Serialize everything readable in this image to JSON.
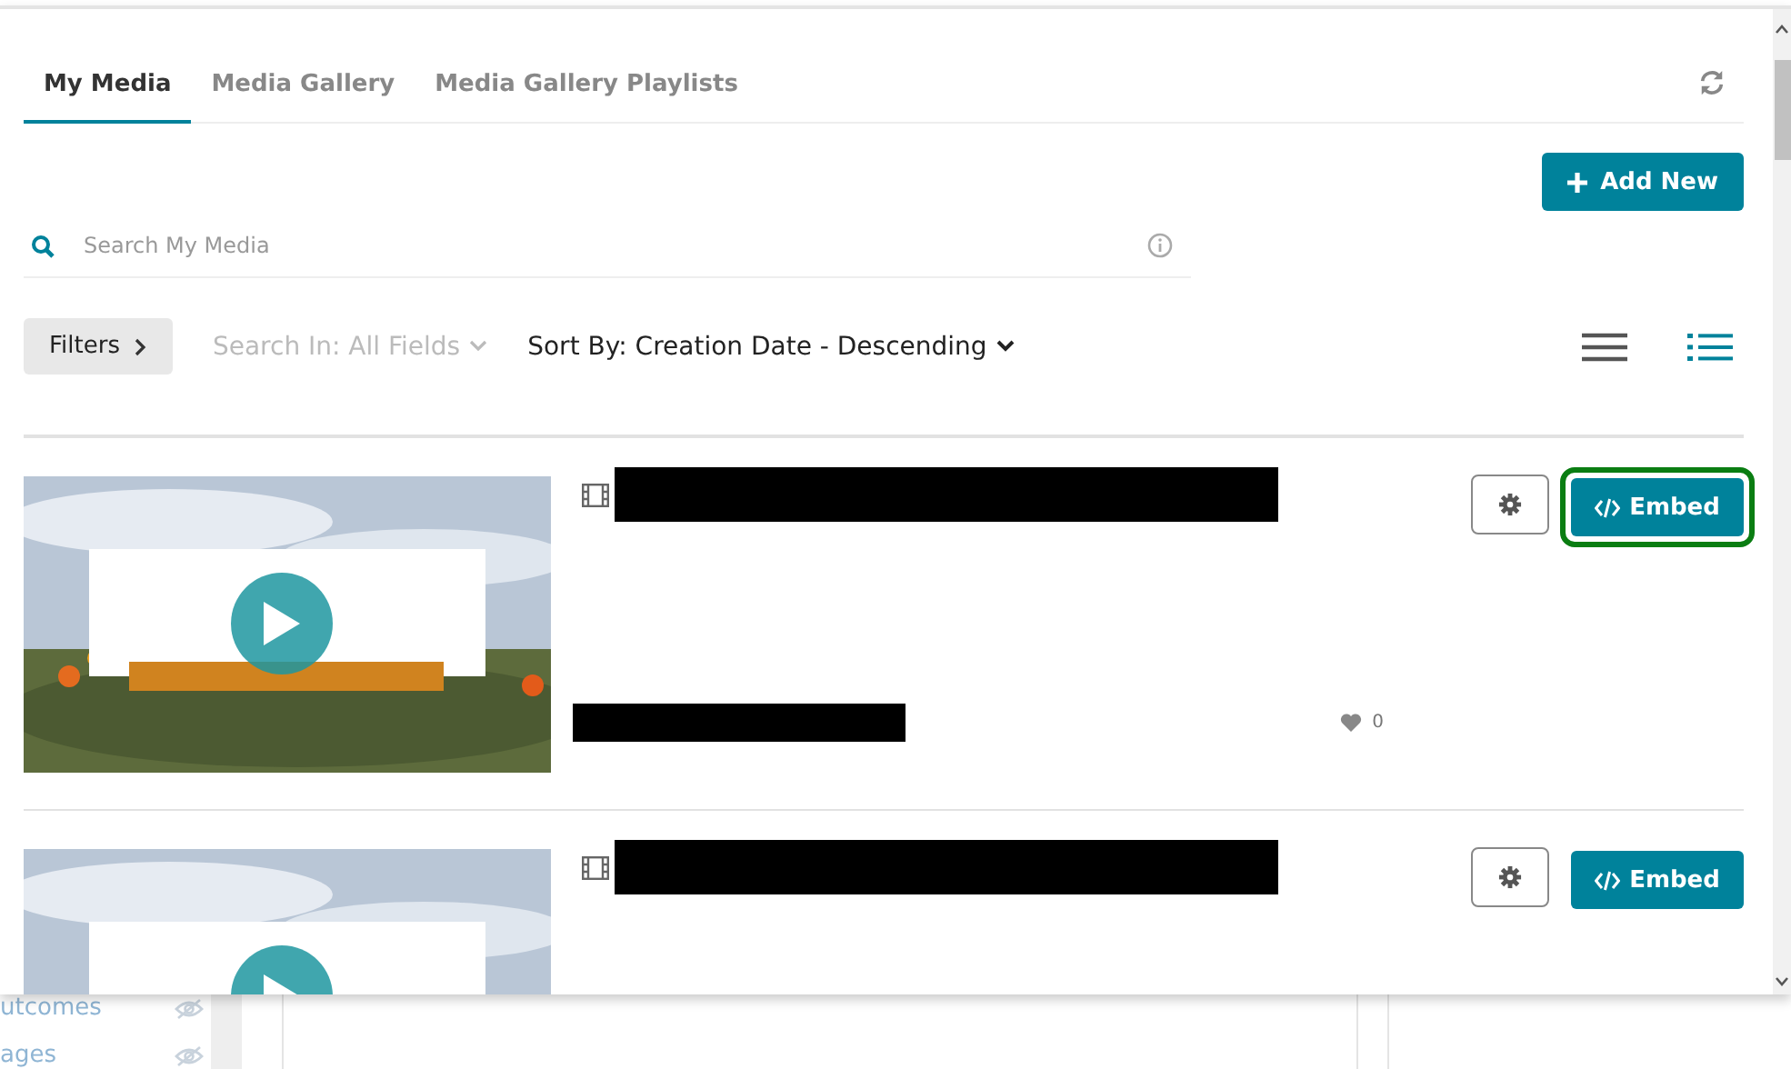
{
  "tabs": [
    {
      "label": "My Media",
      "selected": true
    },
    {
      "label": "Media Gallery",
      "selected": false
    },
    {
      "label": "Media Gallery Playlists",
      "selected": false
    }
  ],
  "add_button": {
    "label": "Add New"
  },
  "search": {
    "placeholder": "Search My Media"
  },
  "filters_button": {
    "label": "Filters"
  },
  "search_in": {
    "label": "Search In: All Fields",
    "disabled": true
  },
  "sort": {
    "label": "Sort By: Creation Date - Descending"
  },
  "views": [
    {
      "kind": "list",
      "selected": false
    },
    {
      "kind": "detailed",
      "selected": true
    }
  ],
  "media": [
    {
      "likes": "0",
      "embed": {
        "label": "Embed",
        "highlighted": true
      }
    },
    {
      "embed": {
        "label": "Embed",
        "highlighted": false
      }
    }
  ],
  "background_sidebar": [
    {
      "label": "utcomes"
    },
    {
      "label": "ages"
    }
  ]
}
